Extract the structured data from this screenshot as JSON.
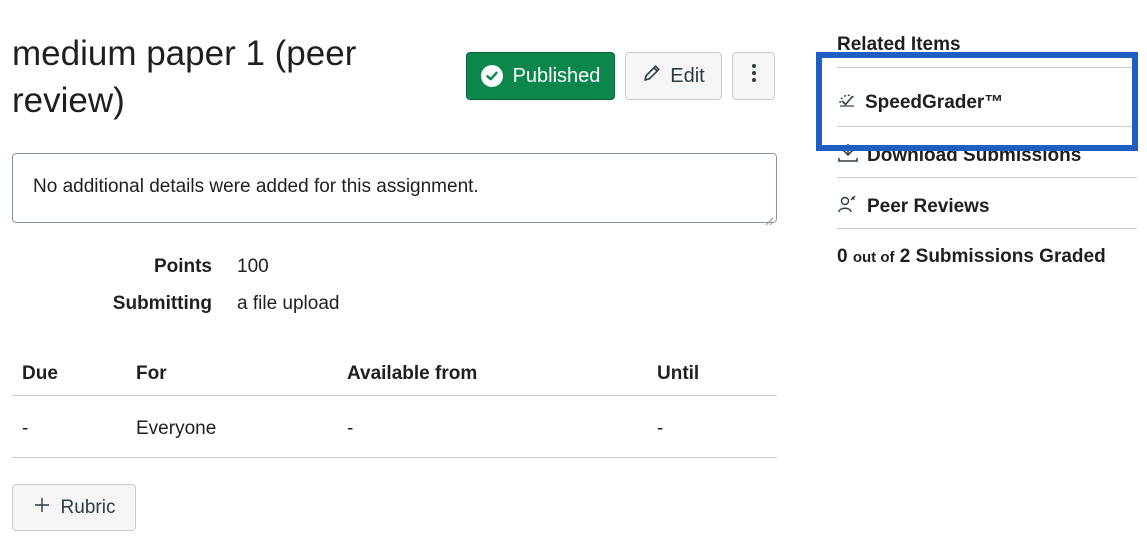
{
  "assignment": {
    "title": "medium paper 1 (peer review)",
    "details": "No additional details were added for this assignment."
  },
  "header": {
    "published_label": "Published",
    "edit_label": "Edit",
    "more_icon": "more-vertical-icon"
  },
  "meta": {
    "points_label": "Points",
    "points_value": "100",
    "submitting_label": "Submitting",
    "submitting_value": "a file upload"
  },
  "due_table": {
    "headers": [
      "Due",
      "For",
      "Available from",
      "Until"
    ],
    "rows": [
      [
        "-",
        "Everyone",
        "-",
        "-"
      ]
    ]
  },
  "rubric_button": {
    "label": "Rubric",
    "icon": "plus-icon"
  },
  "sidebar": {
    "heading": "Related Items",
    "items": [
      {
        "label": "SpeedGrader™",
        "icon": "speedgrader-icon"
      },
      {
        "label": "Download Submissions",
        "icon": "download-icon"
      },
      {
        "label": "Peer Reviews",
        "icon": "peer-review-icon"
      }
    ],
    "graded": {
      "count": "0",
      "out_of": "out of",
      "rest": "2 Submissions Graded"
    }
  },
  "colors": {
    "published_green": "#0b874b",
    "highlight_blue": "#1f5fc1",
    "button_gray": "#f5f5f5"
  }
}
